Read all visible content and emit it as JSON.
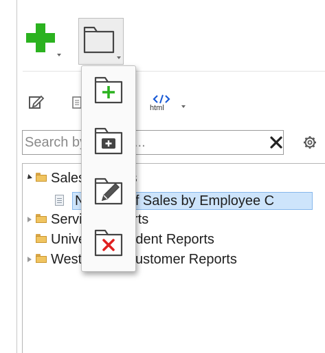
{
  "toolbar": {
    "add_icon": "plus-icon",
    "folder_menu_icon": "folder-icon",
    "edit_icon": "edit-icon",
    "clipboard_icon": "report-icon",
    "html_label": "html"
  },
  "search": {
    "value": "",
    "placeholder": "Search by Names...",
    "clear_icon": "close-icon",
    "settings_icon": "gear-icon"
  },
  "folder_menu": {
    "items": [
      {
        "name": "new-folder",
        "icon": "folder-plus-icon"
      },
      {
        "name": "new-subfolder",
        "icon": "folder-add-icon"
      },
      {
        "name": "rename-folder",
        "icon": "folder-edit-icon"
      },
      {
        "name": "delete-folder",
        "icon": "folder-delete-icon"
      }
    ]
  },
  "tree": {
    "nodes": [
      {
        "label": "Sales Reports",
        "expanded": true
      },
      {
        "label": "Number of Sales by Employee C",
        "selected": true
      },
      {
        "label": "Service Reports",
        "expanded": false
      },
      {
        "label": "University Student Reports"
      },
      {
        "label": "West Coast Customer Reports",
        "expanded": false
      }
    ]
  },
  "colors": {
    "accent_green": "#2bb21f",
    "folder": "#f0c460",
    "selection": "#cde4fb",
    "delete_red": "#e02020"
  }
}
